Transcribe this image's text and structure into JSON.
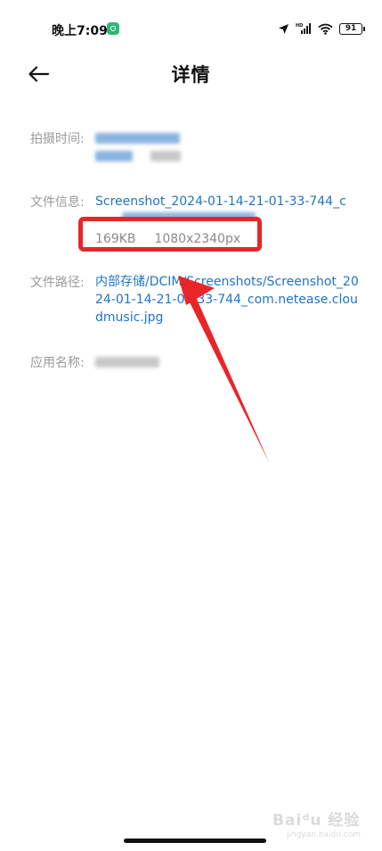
{
  "status_bar": {
    "time": "晚上7:09",
    "battery": "91",
    "icons": [
      "app-notification-icon",
      "location-icon",
      "signal-icon",
      "wifi-icon",
      "battery-icon"
    ]
  },
  "header": {
    "back_icon": "arrow-left-icon",
    "title": "详情"
  },
  "details": {
    "capture_time": {
      "label": "拍摄时间:"
    },
    "file_info": {
      "label": "文件信息:",
      "filename": "Screenshot_2024-01-14-21-01-33-744_c",
      "size": "169KB",
      "resolution": "1080x2340px"
    },
    "file_path": {
      "label": "文件路径:",
      "path": "内部存储/DCIM/Screenshots/Screenshot_2024-01-14-21-01-33-744_com.netease.cloudmusic.jpg"
    },
    "app_name": {
      "label": "应用名称:"
    }
  },
  "annotation_colors": {
    "highlight": "#e8262a",
    "link": "#2074c8"
  },
  "watermark": {
    "main": "Baiᵈu 经验",
    "sub": "jingyan.baidu.com"
  }
}
